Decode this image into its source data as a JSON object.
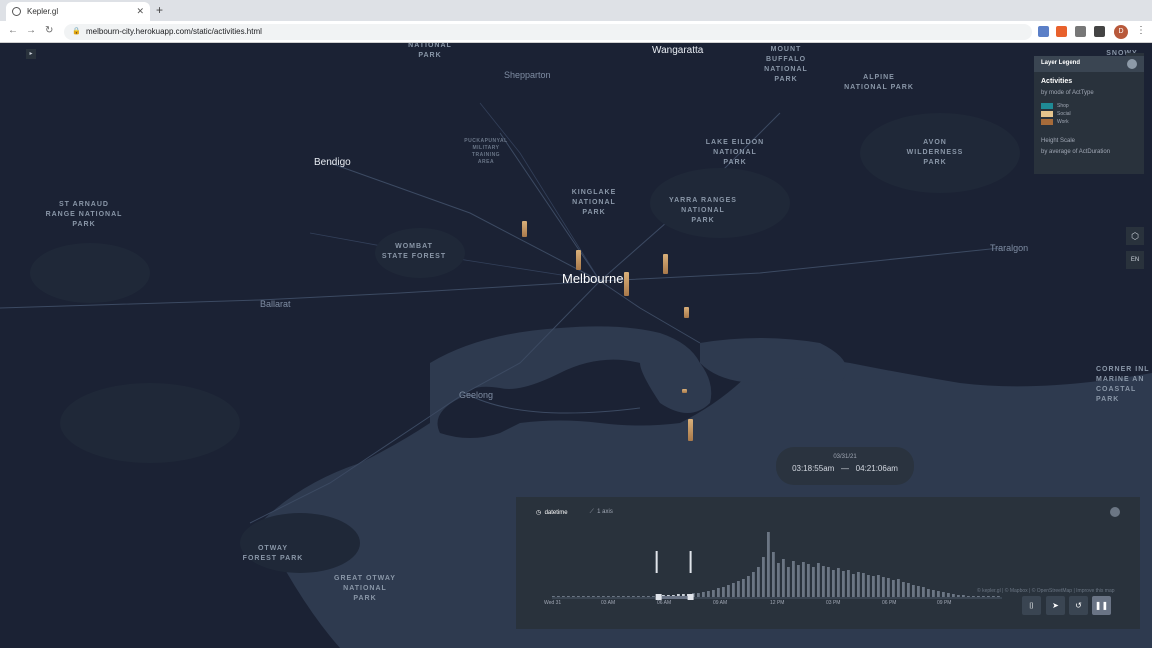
{
  "browser": {
    "tab_title": "Kepler.gl",
    "url": "melbourn-city.herokuapp.com/static/activities.html",
    "profile_initial": "D"
  },
  "map": {
    "places": [
      {
        "label": "NATIONAL\nPARK",
        "small": false
      },
      {
        "label": "MOUNT\nBUFFALO\nNATIONAL\nPARK",
        "small": false
      },
      {
        "label": "ALPINE\nNATIONAL PARK",
        "small": false
      },
      {
        "label": "SNOWY\nNATIONAL\nPARK",
        "small": false
      },
      {
        "label": "PUCKAPUNYAL\nMILITARY\nTRAINING\nAREA",
        "small": true
      },
      {
        "label": "LAKE EILDON\nNATIONAL\nPARK",
        "small": false
      },
      {
        "label": "AVON\nWILDERNESS\nPARK",
        "small": false
      },
      {
        "label": "KINGLAKE\nNATIONAL\nPARK",
        "small": false
      },
      {
        "label": "YARRA RANGES\nNATIONAL\nPARK",
        "small": false
      },
      {
        "label": "ST ARNAUD\nRANGE NATIONAL\nPARK",
        "small": false
      },
      {
        "label": "WOMBAT\nSTATE FOREST",
        "small": false
      },
      {
        "label": "OTWAY\nFOREST PARK",
        "small": false
      },
      {
        "label": "GREAT OTWAY\nNATIONAL\nPARK",
        "small": false
      },
      {
        "label": "CORNER INL\nMARINE AN\nCOASTAL\nPARK",
        "small": false
      }
    ],
    "cities": [
      {
        "label": "Wangaratta"
      },
      {
        "label": "Shepparton"
      },
      {
        "label": "Bendigo"
      },
      {
        "label": "Melbourne"
      },
      {
        "label": "Ballarat"
      },
      {
        "label": "Geelong"
      },
      {
        "label": "Traralgon"
      }
    ]
  },
  "legend": {
    "header": "Layer Legend",
    "layer_name": "Activities",
    "color_by": "by mode of ActType",
    "items": [
      {
        "label": "Shop",
        "color": "#1f8a95"
      },
      {
        "label": "Social",
        "color": "#e6c58e"
      },
      {
        "label": "Work",
        "color": "#a66b3a"
      }
    ],
    "height_scale_label": "Height Scale",
    "height_by": "by average of ActDuration"
  },
  "side_buttons": {
    "lang": "EN"
  },
  "time_bubble": {
    "date": "03/31/21",
    "start": "03:18:55am",
    "separator": "—",
    "end": "04:21:06am"
  },
  "time_panel": {
    "field_tab": "datetime",
    "chart_tab": "1 axis",
    "axis_labels": [
      "Wed 31",
      "03 AM",
      "06 AM",
      "09 AM",
      "12 PM",
      "03 PM",
      "06 PM",
      "09 PM"
    ],
    "histogram": [
      1,
      1,
      1,
      1,
      1,
      1,
      1,
      1,
      1,
      1,
      1,
      1,
      1,
      1,
      1,
      1,
      1,
      1,
      1,
      1,
      1,
      2,
      2,
      2,
      2,
      3,
      3,
      3,
      4,
      4,
      5,
      6,
      7,
      9,
      10,
      12,
      14,
      16,
      18,
      21,
      25,
      30,
      40,
      65,
      45,
      34,
      38,
      30,
      36,
      32,
      35,
      33,
      30,
      34,
      31,
      30,
      27,
      29,
      26,
      27,
      23,
      25,
      24,
      22,
      21,
      22,
      20,
      19,
      17,
      18,
      15,
      14,
      12,
      11,
      10,
      8,
      7,
      6,
      5,
      4,
      3,
      2,
      2,
      1,
      1,
      1,
      1,
      1,
      1,
      1
    ],
    "selection": [
      0.237,
      0.308
    ],
    "accent_color": "#6a7485"
  },
  "attribution": "© kepler.gl | © Mapbox | © OpenStreetMap | Improve this map"
}
